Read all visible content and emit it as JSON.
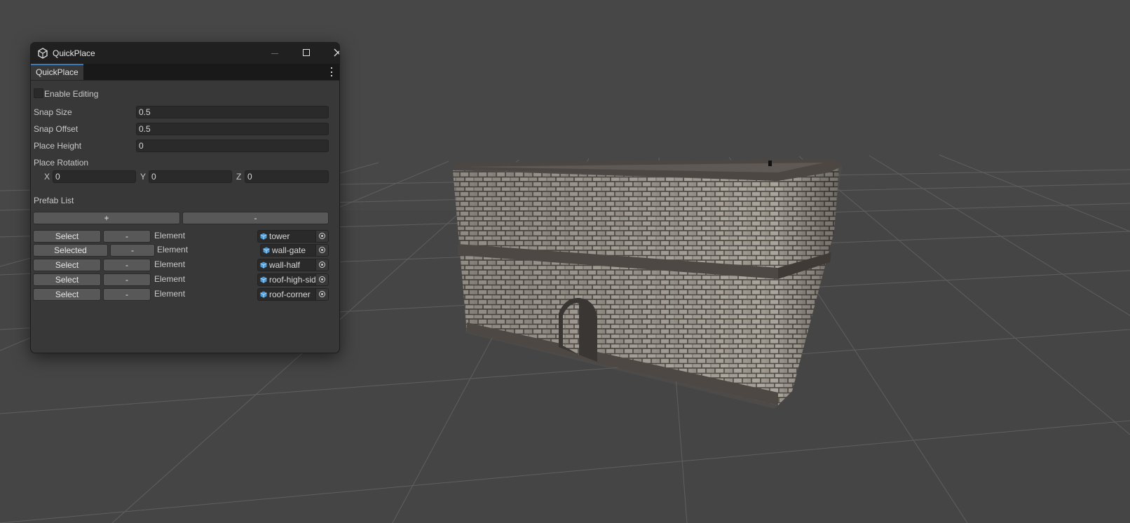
{
  "window": {
    "title": "QuickPlace",
    "tab_label": "QuickPlace",
    "icon": "unity-cube-icon",
    "controls": [
      "minimize-icon",
      "maximize-icon",
      "close-icon"
    ]
  },
  "settings": {
    "enable_editing_label": "Enable Editing",
    "enable_editing_checked": false,
    "snap_size_label": "Snap Size",
    "snap_size_value": "0.5",
    "snap_offset_label": "Snap Offset",
    "snap_offset_value": "0.5",
    "place_height_label": "Place Height",
    "place_height_value": "0",
    "place_rotation_label": "Place Rotation",
    "rotation": {
      "x_label": "X",
      "x_value": "0",
      "y_label": "Y",
      "y_value": "0",
      "z_label": "Z",
      "z_value": "0"
    }
  },
  "prefab_list": {
    "label": "Prefab List",
    "add_label": "+",
    "remove_label": "-",
    "items": [
      {
        "select_label": "Select",
        "remove_label": "-",
        "element_label": "Element",
        "prefab_name": "tower"
      },
      {
        "select_label": "Selected",
        "remove_label": "-",
        "element_label": "Element",
        "prefab_name": "wall-gate"
      },
      {
        "select_label": "Select",
        "remove_label": "-",
        "element_label": "Element",
        "prefab_name": "wall-half"
      },
      {
        "select_label": "Select",
        "remove_label": "-",
        "element_label": "Element",
        "prefab_name": "roof-high-side"
      },
      {
        "select_label": "Select",
        "remove_label": "-",
        "element_label": "Element",
        "prefab_name": "roof-corner"
      }
    ]
  },
  "colors": {
    "viewport_bg": "#474747",
    "panel_bg": "#383838",
    "titlebar_bg": "#202020",
    "tab_accent": "#3a79bb",
    "button_bg": "#585858",
    "field_bg": "#2a2a2a",
    "stone_light": "#9a948a",
    "stone_dark": "#4e4944"
  }
}
